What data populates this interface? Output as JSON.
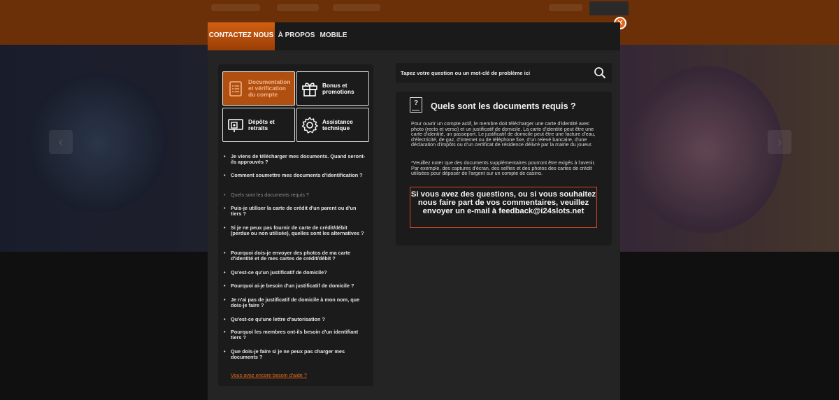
{
  "modal": {
    "tabs": [
      {
        "label": "CONTACTEZ NOUS",
        "active": true
      },
      {
        "label": "À PROPOS",
        "active": false
      },
      {
        "label": "MOBILE",
        "active": false
      }
    ],
    "close_icon": "close-icon",
    "accent_color": "#d25f12"
  },
  "categories": [
    {
      "label": "Documentation et vérification du compte",
      "icon": "document-icon",
      "active": true
    },
    {
      "label": "Bonus et promotions",
      "icon": "gift-icon",
      "active": false
    },
    {
      "label": "Dépôts et retraits",
      "icon": "deposit-icon",
      "active": false
    },
    {
      "label": "Assistance technique",
      "icon": "gear-icon",
      "active": false
    }
  ],
  "faq": [
    "Je viens de télécharger mes documents. Quand seront-ils approuvés ?",
    "Comment soumettre mes documents d'identification ?",
    "Quels sont les documents requis ?",
    "Puis-je utiliser la carte de crédit d'un parent ou d'un tiers ?",
    "Si je ne peux pas fournir de carte de crédit/débit (perdue ou non utilisée), quelles sont les alternatives ?",
    "Pourquoi dois-je envoyer des photos de ma carte d'identité et de mes cartes de crédit/débit ?",
    "Qu'est-ce qu'un justificatif de domicile?",
    "Pourquoi ai-je besoin d'un justificatif de domicile ?",
    "Je n'ai pas de justificatif de domicile à mon nom, que dois-je faire ?",
    "Qu'est-ce qu'une lettre d'autorisation ?",
    "Pourquoi les membres ont-ils besoin d'un identifiant tiers ?",
    "Que dois-je faire si je ne peux pas charger mes documents ?"
  ],
  "faq_current_index": 2,
  "help_link": "Vous avez encore besoin d'aide ?",
  "search": {
    "placeholder": "Tapez votre question ou un mot-clé de problème ici"
  },
  "answer": {
    "icon": "question-document-icon",
    "title": "Quels sont les documents requis ?",
    "paragraph1": "Pour ouvrir un compte actif, le membre doit télécharger une carte d'identité avec photo (recto et verso) et un justificatif de domicile. La carte d'identité peut être une carte d'identité, un passeport. Le justificatif de domicile peut être une facture d'eau, d'électricité, de gaz, d'internet ou de téléphone fixe, d'un relevé bancaire, d'une déclaration d'impôts ou d'un certificat de résidence délivré par la mairie du joueur.",
    "paragraph2": "*Veuillez noter que des documents supplémentaires pourront être exigés à l'avenir. Par exemple, des captures d'écran, des selfies et des photos des cartes de crédit utilisées pour déposer de l'argent sur un compte de casino.",
    "contact_text": "Si vous avez des questions, ou si vous souhaitez nous faire part de vos commentaires, veuillez envoyer un e-mail à feedback@i24slots.net",
    "contact_border_color": "#d6452c"
  }
}
